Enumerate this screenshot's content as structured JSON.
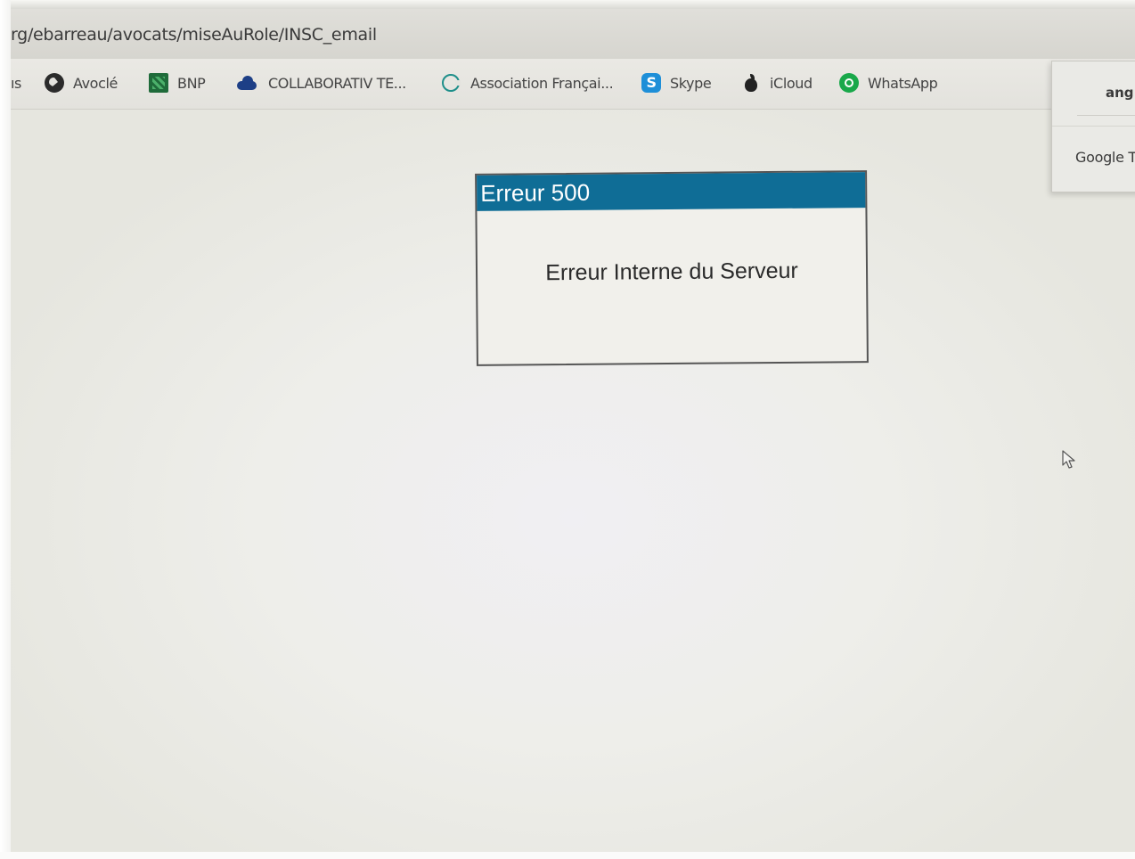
{
  "address_bar": {
    "url": "rg/ebarreau/avocats/miseAuRole/INSC_email"
  },
  "bookmarks": [
    {
      "label": "ıs",
      "icon": "none"
    },
    {
      "label": "Avoclé",
      "icon": "globe-icon"
    },
    {
      "label": "BNP",
      "icon": "bnp-icon"
    },
    {
      "label": "COLLABORATIV TE...",
      "icon": "onedrive-cloud-icon"
    },
    {
      "label": "Association Françai...",
      "icon": "association-icon"
    },
    {
      "label": "Skype",
      "icon": "skype-icon"
    },
    {
      "label": "iCloud",
      "icon": "apple-icon"
    },
    {
      "label": "WhatsApp",
      "icon": "whatsapp-icon"
    }
  ],
  "error_dialog": {
    "title": "Erreur 500",
    "message": "Erreur Interne du Serveur",
    "title_color": "#0f6d96"
  },
  "popup": {
    "top_text": "ang",
    "bottom_text": "Google T"
  },
  "icons": {
    "skype_letter": "S"
  }
}
